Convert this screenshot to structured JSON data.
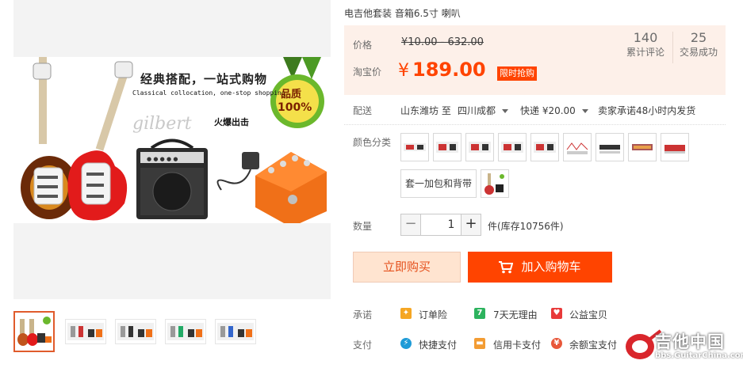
{
  "product": {
    "title": "电吉他套装 音箱6.5寸 喇叭"
  },
  "banner": {
    "headline": "经典搭配，一站式购物",
    "subline": "Classical collocation, one-stop shopping",
    "brand": "gilbert",
    "fire_text": "火爆出击",
    "badge_line1": "品质",
    "badge_line2": "100%"
  },
  "price": {
    "label": "价格",
    "original": "¥10.00 - 632.00",
    "tb_label": "淘宝价",
    "currency": "¥",
    "value": "189.00",
    "limited_tag": "限时抢购",
    "color_accent": "#ff4400"
  },
  "stats": [
    {
      "num": "140",
      "caption": "累计评论"
    },
    {
      "num": "25",
      "caption": "交易成功"
    }
  ],
  "shipping": {
    "label": "配送",
    "from": "山东潍坊 至",
    "to": "四川成都",
    "express": "快递 ¥20.00",
    "promise": "卖家承诺48小时内发货"
  },
  "sku": {
    "label": "颜色分类",
    "option_text": "套一加包和背带"
  },
  "quantity": {
    "label": "数量",
    "minus": "−",
    "value": "1",
    "plus": "+",
    "stock": "件(库存10756件)"
  },
  "actions": {
    "buy_now": "立即购买",
    "add_cart": "加入购物车"
  },
  "promise": {
    "label": "承诺",
    "items": [
      "订单险",
      "7天无理由",
      "公益宝贝"
    ]
  },
  "payment": {
    "label": "支付",
    "items": [
      "快捷支付",
      "信用卡支付",
      "余额宝支付"
    ]
  },
  "watermark": {
    "name": "吉他中国",
    "url": "bbs.GuitarChina.com"
  }
}
